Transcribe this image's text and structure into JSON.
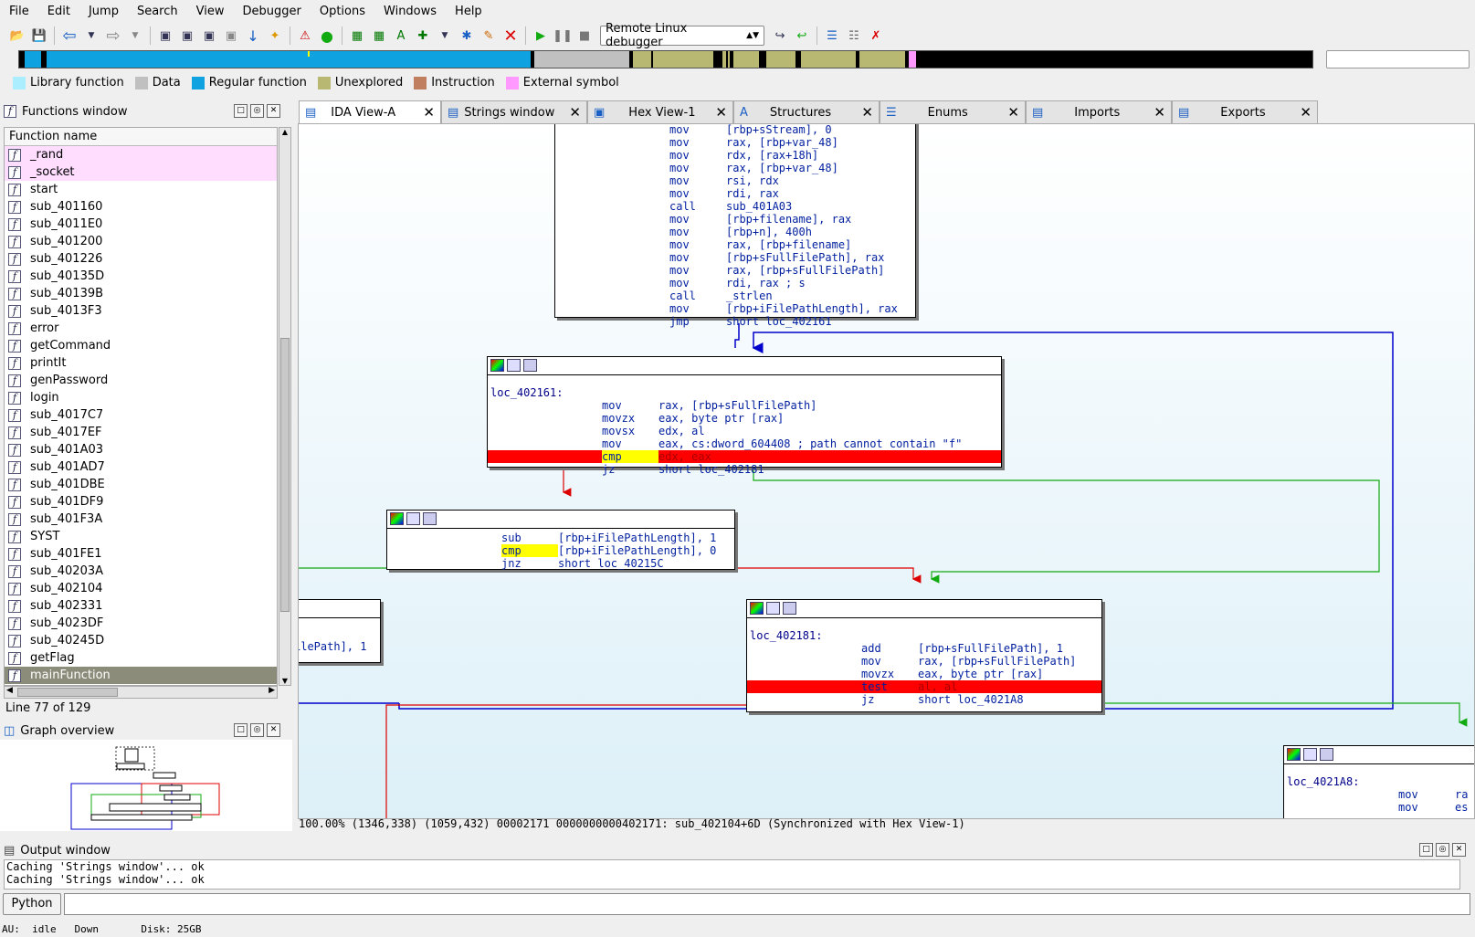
{
  "menu": [
    "File",
    "Edit",
    "Jump",
    "Search",
    "View",
    "Debugger",
    "Options",
    "Windows",
    "Help"
  ],
  "toolbar": {
    "debugger": "Remote Linux debugger"
  },
  "legend": [
    {
      "label": "Library function",
      "color": "#aaeeff"
    },
    {
      "label": "Data",
      "color": "#c0c0c0"
    },
    {
      "label": "Regular function",
      "color": "#0ea2e0"
    },
    {
      "label": "Unexplored",
      "color": "#b8b873"
    },
    {
      "label": "Instruction",
      "color": "#c08060"
    },
    {
      "label": "External symbol",
      "color": "#ff99ff"
    }
  ],
  "functions_window": {
    "title": "Functions window",
    "header": "Function name",
    "items": [
      "_rand",
      "_socket",
      "start",
      "sub_401160",
      "sub_4011E0",
      "sub_401200",
      "sub_401226",
      "sub_40135D",
      "sub_40139B",
      "sub_4013F3",
      "error",
      "getCommand",
      "printIt",
      "genPassword",
      "login",
      "sub_4017C7",
      "sub_4017EF",
      "sub_401A03",
      "sub_401AD7",
      "sub_401DBE",
      "sub_401DF9",
      "sub_401F3A",
      "SYST",
      "sub_401FE1",
      "sub_40203A",
      "sub_402104",
      "sub_402331",
      "sub_4023DF",
      "sub_40245D",
      "getFlag",
      "mainFunction"
    ],
    "line_info": "Line 77 of 129"
  },
  "graph_overview": {
    "title": "Graph overview"
  },
  "tabs": [
    "IDA View-A",
    "Strings window",
    "Hex View-1",
    "Structures",
    "Enums",
    "Imports",
    "Exports"
  ],
  "blocks": {
    "b1": [
      [
        "mov",
        "[rbp+sStream], 0"
      ],
      [
        "mov",
        "rax, [rbp+var_48]"
      ],
      [
        "mov",
        "rdx, [rax+18h]"
      ],
      [
        "mov",
        "rax, [rbp+var_48]"
      ],
      [
        "mov",
        "rsi, rdx"
      ],
      [
        "mov",
        "rdi, rax"
      ],
      [
        "call",
        "sub_401A03"
      ],
      [
        "mov",
        "[rbp+filename], rax"
      ],
      [
        "mov",
        "[rbp+n], 400h"
      ],
      [
        "mov",
        "rax, [rbp+filename]"
      ],
      [
        "mov",
        "[rbp+sFullFilePath], rax"
      ],
      [
        "mov",
        "rax, [rbp+sFullFilePath]"
      ],
      [
        "mov",
        "rdi, rax ; s"
      ],
      [
        "call",
        "_strlen"
      ],
      [
        "mov",
        "[rbp+iFilePathLength], rax"
      ],
      [
        "jmp",
        "short loc_402161"
      ]
    ],
    "b2_label": "loc_402161:",
    "b2": [
      [
        "mov",
        "rax, [rbp+sFullFilePath]"
      ],
      [
        "movzx",
        "eax, byte ptr [rax]"
      ],
      [
        "movsx",
        "edx, al"
      ],
      [
        "mov",
        "eax, cs:dword_604408 ; path cannot contain \"f\""
      ],
      [
        "cmp",
        "edx, eax"
      ],
      [
        "jz",
        "short loc_402181"
      ]
    ],
    "b3": [
      [
        "sub",
        "[rbp+iFilePathLength], 1"
      ],
      [
        "cmp",
        "[rbp+iFilePathLength], 0"
      ],
      [
        "jnz",
        "short loc_40215C"
      ]
    ],
    "b4_text": "ilePath], 1",
    "b5_label": "loc_402181:",
    "b5": [
      [
        "add",
        "[rbp+sFullFilePath], 1"
      ],
      [
        "mov",
        "rax, [rbp+sFullFilePath]"
      ],
      [
        "movzx",
        "eax, byte ptr [rax]"
      ],
      [
        "test",
        "al, al"
      ],
      [
        "jz",
        "short loc_4021A8"
      ]
    ],
    "b6_label": "loc_4021A8:",
    "b6": [
      [
        "mov",
        "ra"
      ],
      [
        "mov",
        "es"
      ]
    ]
  },
  "status_line": "100.00% (1346,338) (1059,432) 00002171 0000000000402171: sub_402104+6D (Synchronized with Hex View-1)",
  "output": {
    "title": "Output window",
    "lines": [
      "Caching 'Strings window'... ok",
      "Caching 'Strings window'... ok"
    ],
    "python": "Python"
  },
  "bottom_status": "AU:  idle   Down       Disk: 25GB"
}
